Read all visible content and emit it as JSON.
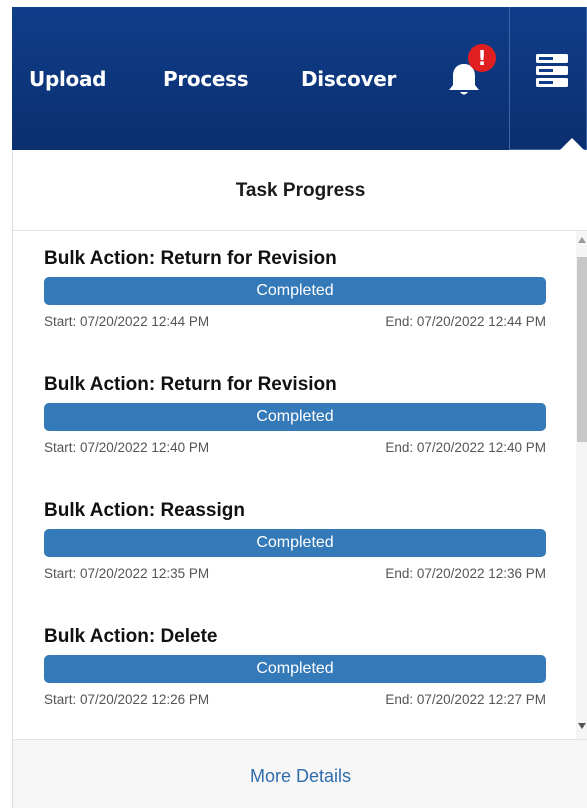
{
  "nav": {
    "upload": "Upload",
    "process": "Process",
    "discover": "Discover",
    "notification_badge": "!",
    "colors": {
      "bg": "#0f3d8a",
      "badge": "#e02020"
    },
    "icons": {
      "bell": "bell-icon",
      "menu": "server-menu-icon"
    }
  },
  "panel": {
    "title": "Task Progress",
    "tasks": [
      {
        "title": "Bulk Action: Return for Revision",
        "status": "Completed",
        "progress": 1.0,
        "start": "Start: 07/20/2022 12:44 PM",
        "end": "End: 07/20/2022 12:44 PM"
      },
      {
        "title": "Bulk Action: Return for Revision",
        "status": "Completed",
        "progress": 1.0,
        "start": "Start: 07/20/2022 12:40 PM",
        "end": "End: 07/20/2022 12:40 PM"
      },
      {
        "title": "Bulk Action: Reassign",
        "status": "Completed",
        "progress": 1.0,
        "start": "Start: 07/20/2022 12:35 PM",
        "end": "End: 07/20/2022 12:36 PM"
      },
      {
        "title": "Bulk Action: Delete",
        "status": "Completed",
        "progress": 1.0,
        "start": "Start: 07/20/2022 12:26 PM",
        "end": "End: 07/20/2022 12:27 PM"
      }
    ],
    "more_details": "More Details",
    "colors": {
      "bar": "#3479b8",
      "link": "#2e6daa"
    }
  }
}
